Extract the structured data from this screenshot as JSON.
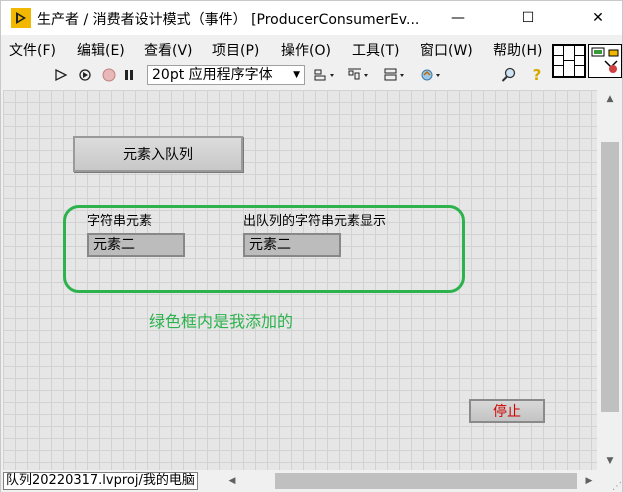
{
  "window": {
    "title": "生产者 / 消费者设计模式（事件）  [ProducerConsumerEv...",
    "minimize": "—",
    "maximize": "☐",
    "close": "✕"
  },
  "menu": {
    "items": [
      "文件(F)",
      "编辑(E)",
      "查看(V)",
      "项目(P)",
      "操作(O)",
      "工具(T)",
      "窗口(W)",
      "帮助(H)"
    ]
  },
  "toolbar": {
    "font_select": "20pt 应用程序字体",
    "icons": [
      "run-arrow-icon",
      "run-continuous-icon",
      "abort-icon",
      "pause-icon",
      "align-icon",
      "distribute-icon",
      "resize-icon",
      "reorder-icon",
      "search-icon",
      "help-icon"
    ]
  },
  "panel": {
    "enqueue_button": "元素入队列",
    "string_label": "字符串元素",
    "string_value": "元素二",
    "dequeue_label": "出队列的字符串元素显示",
    "dequeue_value": "元素二",
    "note": "绿色框内是我添加的",
    "stop_button": "停止",
    "note_color": "#2db24d"
  },
  "status": {
    "path": "队列20220317.lvproj/我的电脑"
  }
}
